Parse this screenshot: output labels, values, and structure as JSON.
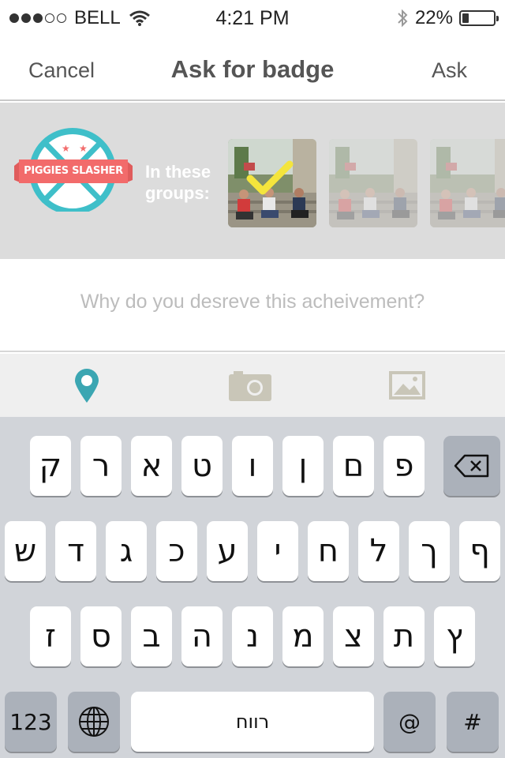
{
  "status_bar": {
    "carrier": "BELL",
    "time": "4:21 PM",
    "battery": "22%",
    "battery_level": 0.22,
    "signal_bars": 3
  },
  "nav": {
    "cancel": "Cancel",
    "title": "Ask for badge",
    "ask": "Ask"
  },
  "badge": {
    "name": "PIGGIES SLASHER",
    "groups_label_1": "In these",
    "groups_label_2": "groups:",
    "accent_color": "#3fbfc9",
    "ribbon_color": "#f26b6b"
  },
  "groups": [
    {
      "selected": true
    },
    {
      "selected": false
    },
    {
      "selected": false
    }
  ],
  "form": {
    "placeholder": "Why do you desreve this acheivement?"
  },
  "toolbar": {
    "icons": [
      "location-pin-icon",
      "camera-icon",
      "image-icon"
    ],
    "pin_color": "#3ba6b2"
  },
  "keyboard": {
    "row1": [
      "ק",
      "ר",
      "א",
      "ט",
      "ו",
      "ן",
      "ם",
      "פ"
    ],
    "row2": [
      "ש",
      "ד",
      "ג",
      "כ",
      "ע",
      "י",
      "ח",
      "ל",
      "ך",
      "ף"
    ],
    "row3": [
      "ז",
      "ס",
      "ב",
      "ה",
      "נ",
      "מ",
      "צ",
      "ת",
      "ץ"
    ],
    "numbers": "123",
    "space": "רווח",
    "at": "@",
    "hash": "#"
  }
}
